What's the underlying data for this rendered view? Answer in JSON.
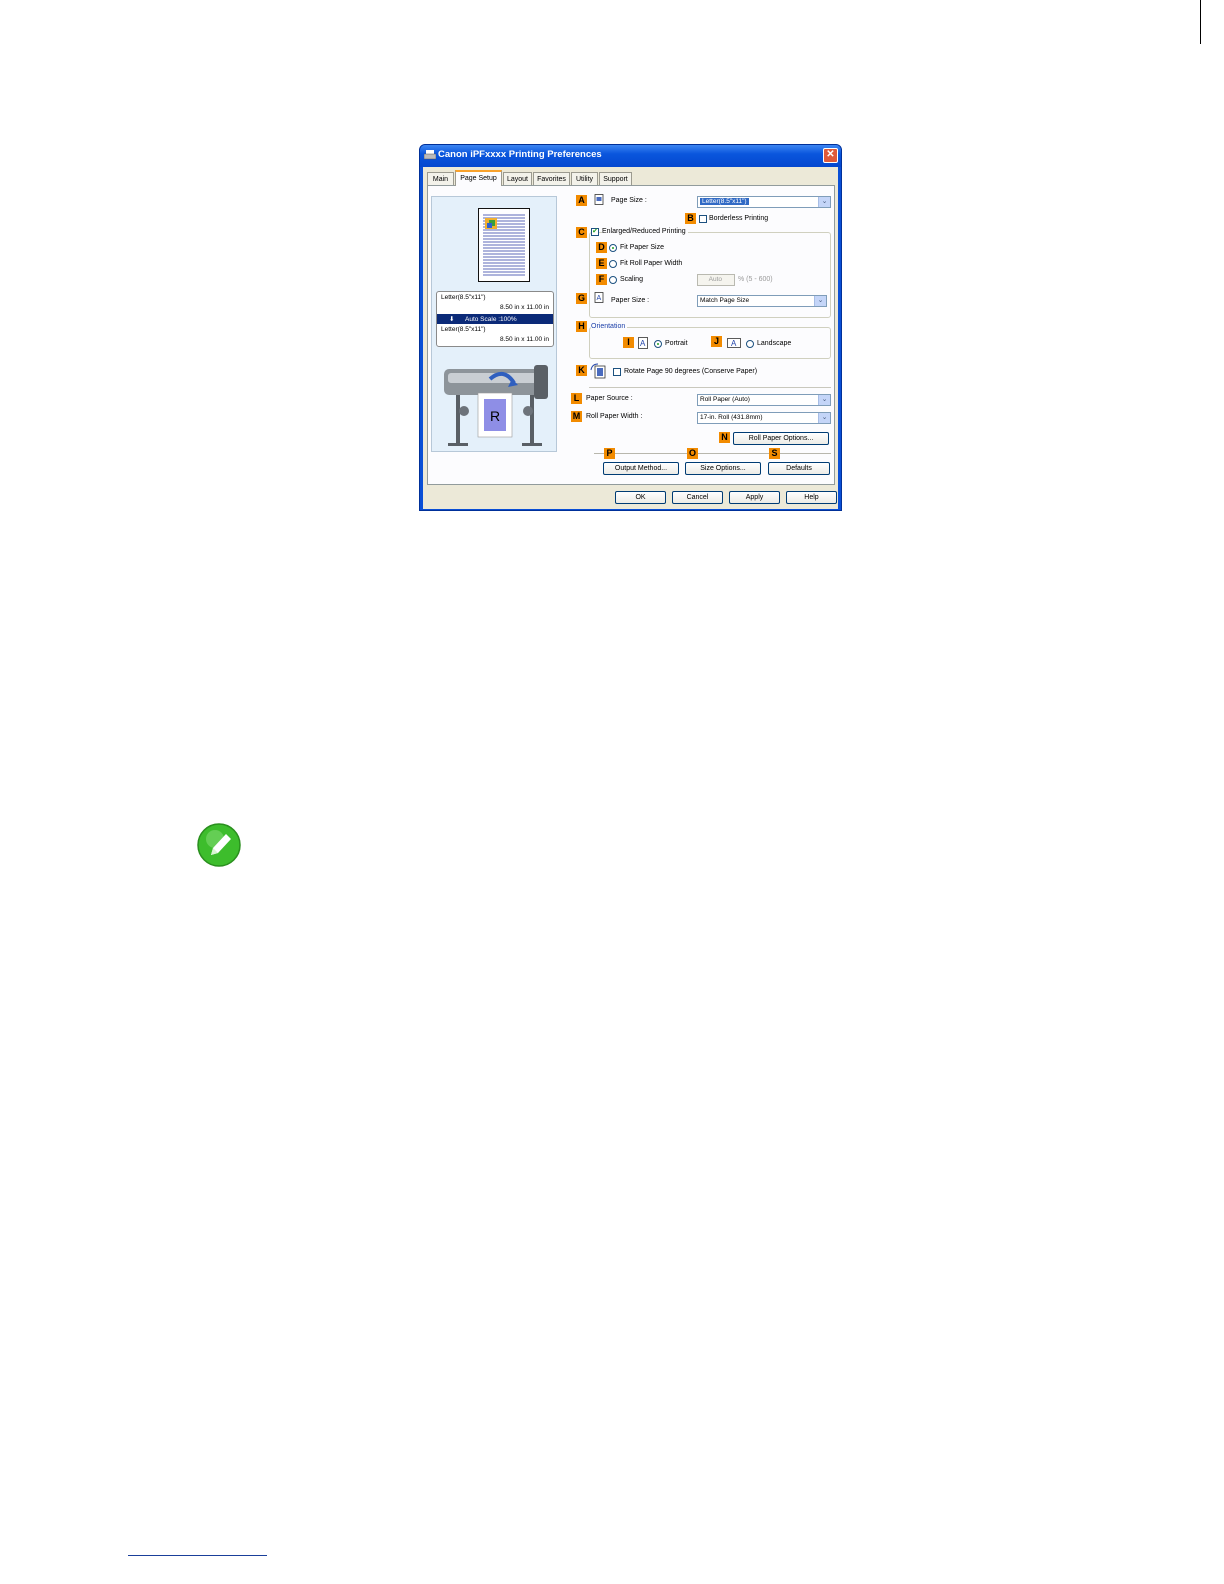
{
  "dialog": {
    "title": "Canon iPFxxxx Printing Preferences",
    "close_glyph": "✕",
    "tabs": [
      "Main",
      "Page Setup",
      "Layout",
      "Favorites",
      "Utility",
      "Support"
    ],
    "active_tab": "Page Setup"
  },
  "preview": {
    "line1": "Letter(8.5\"x11\")",
    "line2": "8.50 in x 11.00 in",
    "line3": "Auto Scale :100%",
    "line4": "Letter(8.5\"x11\")",
    "line5": "8.50 in x 11.00 in",
    "arrow_glyph": "⬇"
  },
  "badges": {
    "A": "A",
    "B": "B",
    "C": "C",
    "D": "D",
    "E": "E",
    "F": "F",
    "G": "G",
    "H": "H",
    "I": "I",
    "J": "J",
    "K": "K",
    "L": "L",
    "M": "M",
    "N": "N",
    "O": "O",
    "P": "P",
    "S": "S"
  },
  "settings": {
    "page_size_label": "Page Size :",
    "page_size_value": "Letter(8.5\"x11\")",
    "borderless_label": "Borderless Printing",
    "enlarged_label": "Enlarged/Reduced Printing",
    "enlarged_checked": true,
    "check_glyph": "✔",
    "fit_paper_size": "Fit Paper Size",
    "fit_roll_width": "Fit Roll Paper Width",
    "scaling_label": "Scaling",
    "scaling_value": "Auto",
    "scaling_range": "% (5 - 600)",
    "paper_size_label": "Paper Size :",
    "paper_size_value": "Match Page Size",
    "orientation_label": "Orientation",
    "portrait_label": "Portrait",
    "landscape_label": "Landscape",
    "rotate_label": "Rotate Page 90 degrees (Conserve Paper)",
    "paper_source_label": "Paper Source :",
    "paper_source_value": "Roll Paper (Auto)",
    "roll_width_label": "Roll Paper Width :",
    "roll_width_value": "17-in. Roll (431.8mm)",
    "dropdown_glyph": "⌄"
  },
  "buttons": {
    "roll_options": "Roll Paper Options...",
    "output_method": "Output Method...",
    "size_options": "Size Options...",
    "defaults": "Defaults",
    "ok": "OK",
    "cancel": "Cancel",
    "apply": "Apply",
    "help": "Help"
  },
  "colors": {
    "accent_badge": "#f28b00",
    "titlebar": "#0a56dd",
    "note_icon": "#3dbd2c"
  }
}
